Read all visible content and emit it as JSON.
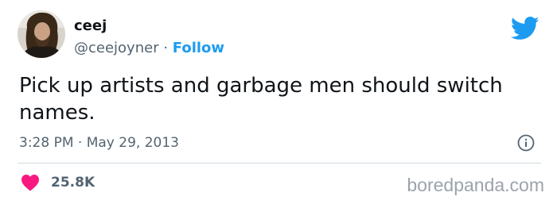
{
  "tweet": {
    "author": {
      "display_name": "ceej",
      "handle": "@ceejoyner",
      "separator": " · ",
      "follow_label": "Follow",
      "avatar_icon": "avatar-photo"
    },
    "text": "Pick up artists and garbage men should switch names.",
    "timestamp": "3:28 PM · May 29, 2013",
    "likes": "25.8K",
    "icons": {
      "brand": "twitter-bird-icon",
      "info": "info-icon",
      "like": "heart-icon"
    },
    "colors": {
      "accent": "#1d9bf0",
      "heart": "#f91880",
      "muted_text": "#536471",
      "divider": "#cfd9de"
    }
  },
  "watermark": "boredpanda.com"
}
